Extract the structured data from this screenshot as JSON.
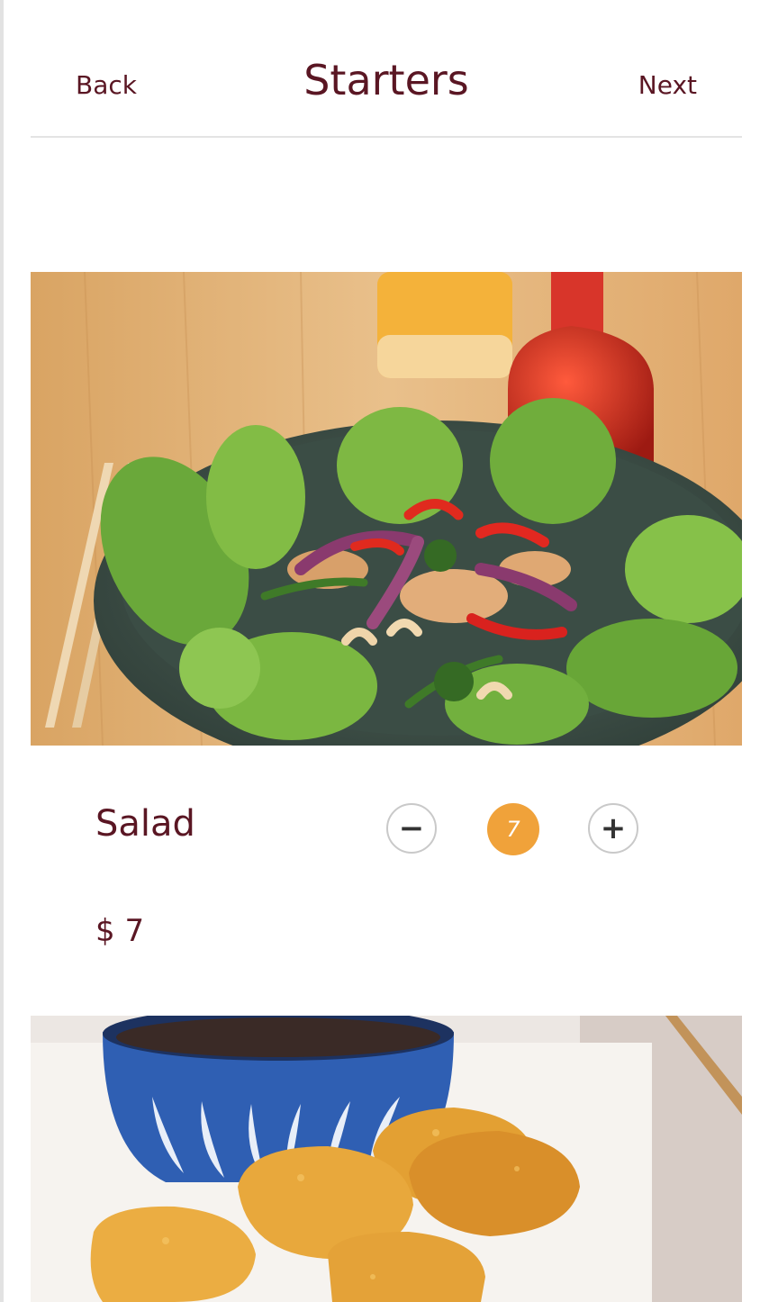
{
  "header": {
    "back_label": "Back",
    "title": "Starters",
    "next_label": "Next"
  },
  "items": [
    {
      "name": "Salad",
      "price": "$ 7",
      "quantity": "7",
      "decrement_label": "−",
      "increment_label": "+"
    }
  ],
  "colors": {
    "brand": "#5a1623",
    "accent": "#f0a23a",
    "divider": "#e4e4e4",
    "button_border": "#c9c9c9"
  },
  "icons": {
    "decrement": "minus-icon",
    "increment": "plus-icon"
  }
}
